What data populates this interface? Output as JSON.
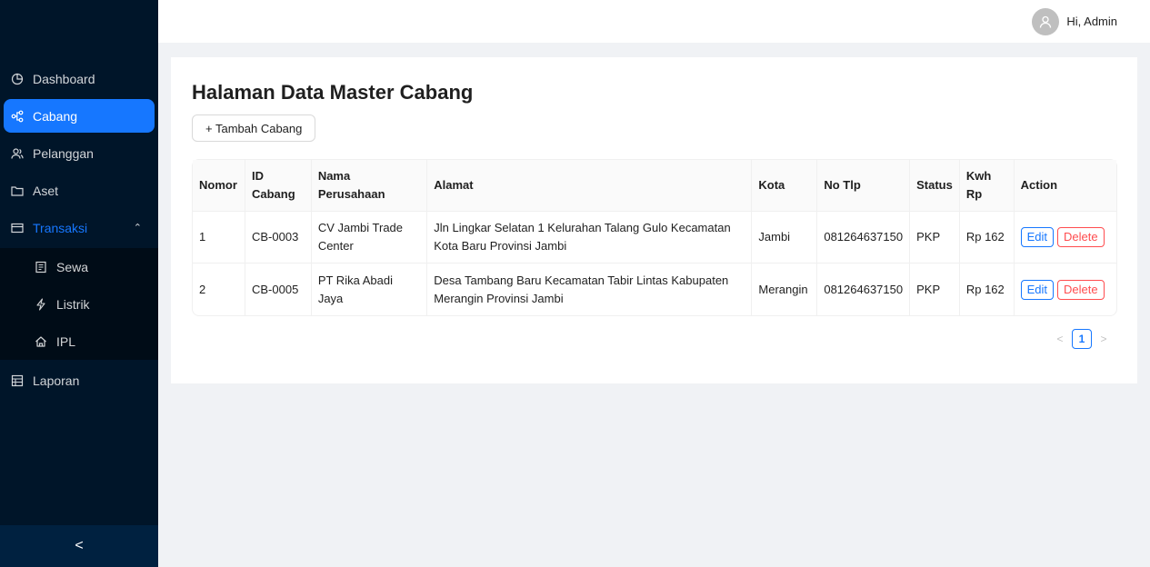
{
  "header": {
    "greeting": "Hi, Admin"
  },
  "sidebar": {
    "items": [
      {
        "label": "Dashboard",
        "icon": "pie-chart-icon"
      },
      {
        "label": "Cabang",
        "icon": "branches-icon"
      },
      {
        "label": "Pelanggan",
        "icon": "users-icon"
      },
      {
        "label": "Aset",
        "icon": "folder-icon"
      },
      {
        "label": "Transaksi",
        "icon": "credit-card-icon"
      },
      {
        "label": "Laporan",
        "icon": "table-icon"
      }
    ],
    "subitems": [
      {
        "label": "Sewa",
        "icon": "file-text-icon"
      },
      {
        "label": "Listrik",
        "icon": "thunderbolt-icon"
      },
      {
        "label": "IPL",
        "icon": "home-icon"
      }
    ],
    "collapse_glyph": "<"
  },
  "page": {
    "title": "Halaman Data Master Cabang",
    "add_button": "+ Tambah Cabang"
  },
  "table": {
    "columns": [
      "Nomor",
      "ID Cabang",
      "Nama Perusahaan",
      "Alamat",
      "Kota",
      "No Tlp",
      "Status",
      "Kwh Rp",
      "Action"
    ],
    "rows": [
      {
        "no": "1",
        "id": "CB-0003",
        "nama": "CV Jambi Trade Center",
        "alamat": "Jln Lingkar Selatan 1 Kelurahan Talang Gulo Kecamatan Kota Baru Provinsi Jambi",
        "kota": "Jambi",
        "tlp": "081264637150",
        "status": "PKP",
        "kwh": "Rp 162",
        "edit": "Edit",
        "delete": "Delete"
      },
      {
        "no": "2",
        "id": "CB-0005",
        "nama": "PT Rika Abadi Jaya",
        "alamat": "Desa Tambang Baru Kecamatan Tabir Lintas Kabupaten Merangin Provinsi Jambi",
        "kota": "Merangin",
        "tlp": "081264637150",
        "status": "PKP",
        "kwh": "Rp 162",
        "edit": "Edit",
        "delete": "Delete"
      }
    ]
  },
  "pagination": {
    "prev": "<",
    "current": "1",
    "next": ">"
  },
  "colors": {
    "sidebar_bg": "#001529",
    "primary": "#1677ff",
    "danger": "#ff4d4f"
  }
}
